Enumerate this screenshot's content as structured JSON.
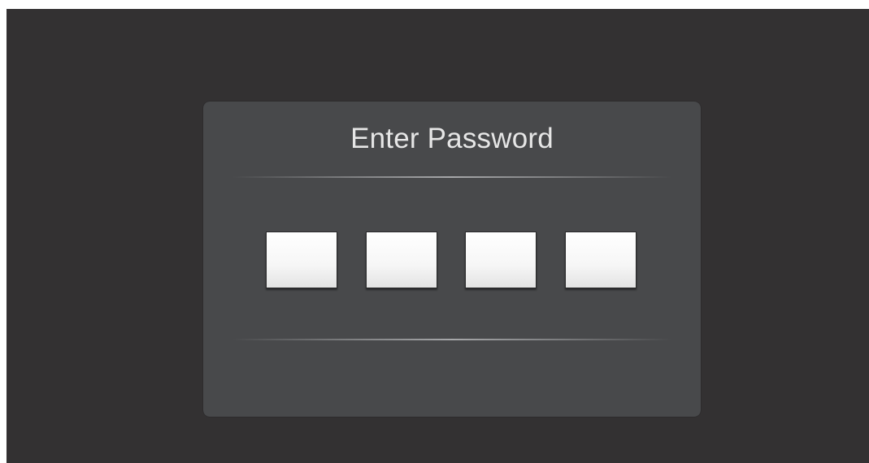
{
  "dialog": {
    "title": "Enter Password"
  },
  "pin": {
    "digits": [
      "",
      "",
      "",
      ""
    ]
  }
}
